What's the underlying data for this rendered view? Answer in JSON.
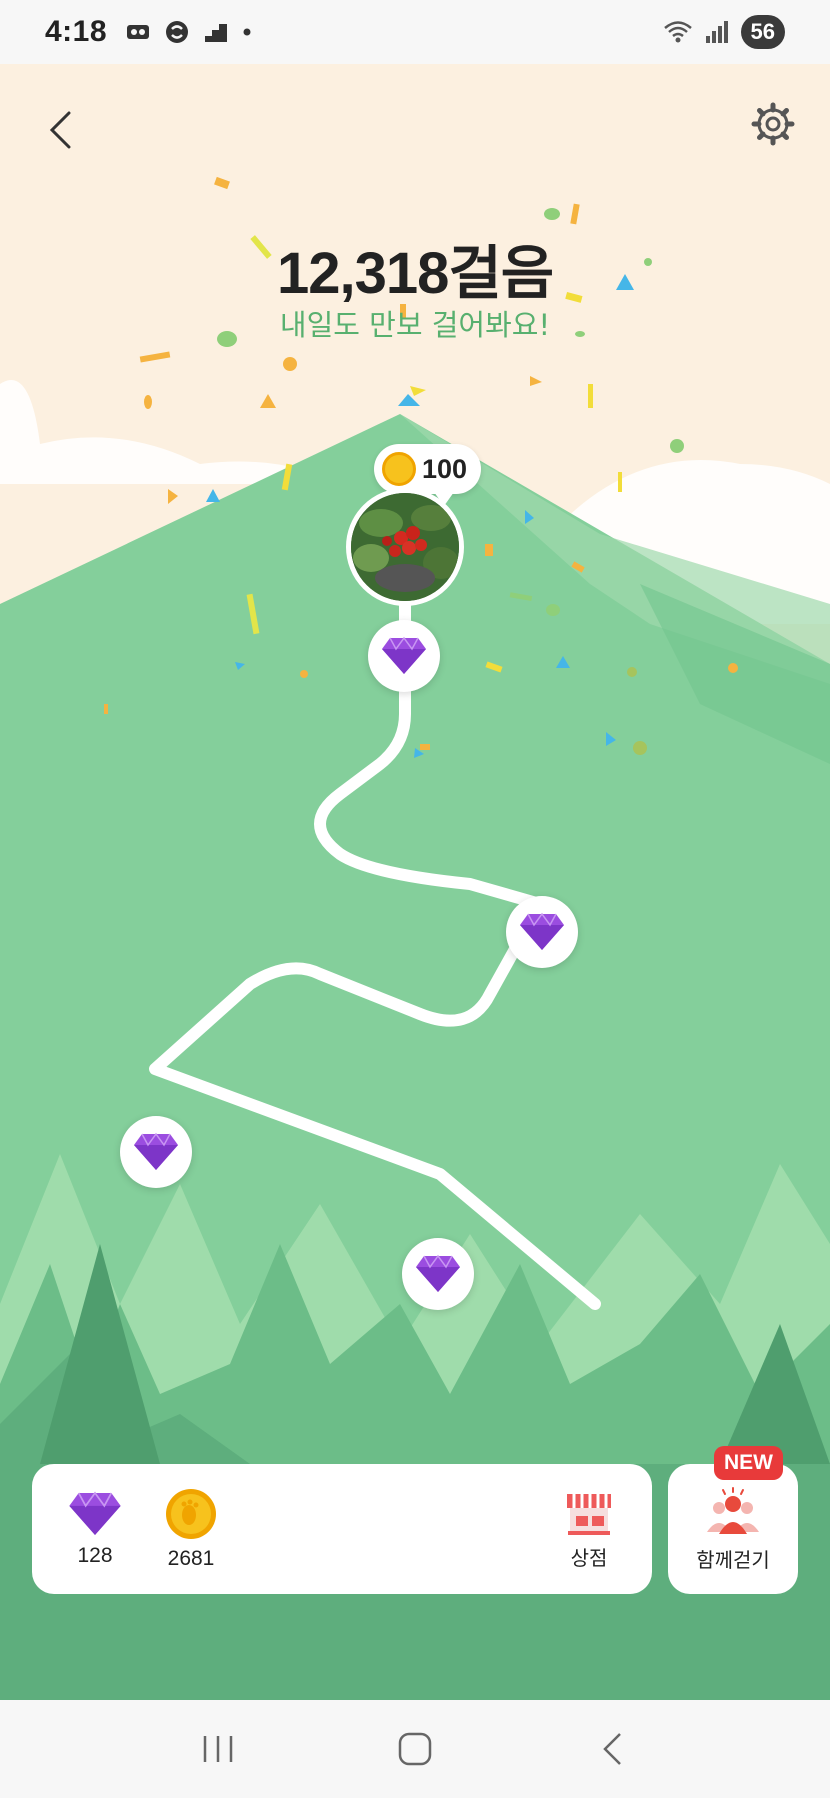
{
  "status_bar": {
    "time": "4:18",
    "battery": "56"
  },
  "header": {
    "back_icon": "chevron-left-icon",
    "settings_icon": "gear-icon"
  },
  "steps": {
    "title": "12,318걸음",
    "subtitle": "내일도 만보 걸어봐요!"
  },
  "reward": {
    "amount": "100"
  },
  "bottom": {
    "gems_count": "128",
    "coins_count": "2681",
    "shop_label": "상점",
    "walk_together_label": "함께걷기",
    "new_badge": "NEW"
  },
  "colors": {
    "sky": "#fcf0e0",
    "mountain": "#84cf9b",
    "accent_green": "#58b06f",
    "gem": "#9b4de0",
    "coin": "#f7c21d",
    "new_badge": "#e83a3a"
  }
}
